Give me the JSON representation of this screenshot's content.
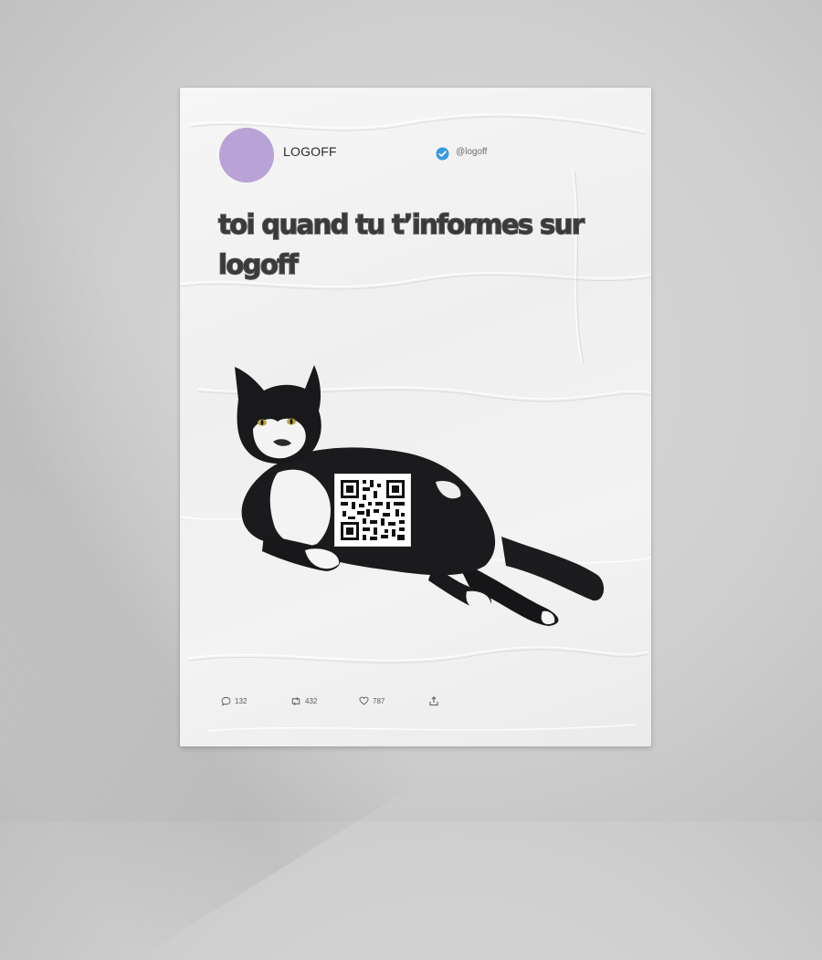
{
  "tweet": {
    "display_name": "LOGOFF",
    "handle": "@logoff",
    "text_line1": "toi quand tu t’informes sur",
    "text_line2": "logoff",
    "avatar_color": "#b9a2d6",
    "verified_color": "#3a9be0"
  },
  "actions": {
    "replies": "132",
    "retweets": "432",
    "likes": "787",
    "reply_icon": "comment-icon",
    "retweet_icon": "retweet-icon",
    "like_icon": "heart-icon",
    "share_icon": "share-icon"
  },
  "image": {
    "subject_icon": "tuxedo-cat-image",
    "code_icon": "qr-code-icon"
  }
}
